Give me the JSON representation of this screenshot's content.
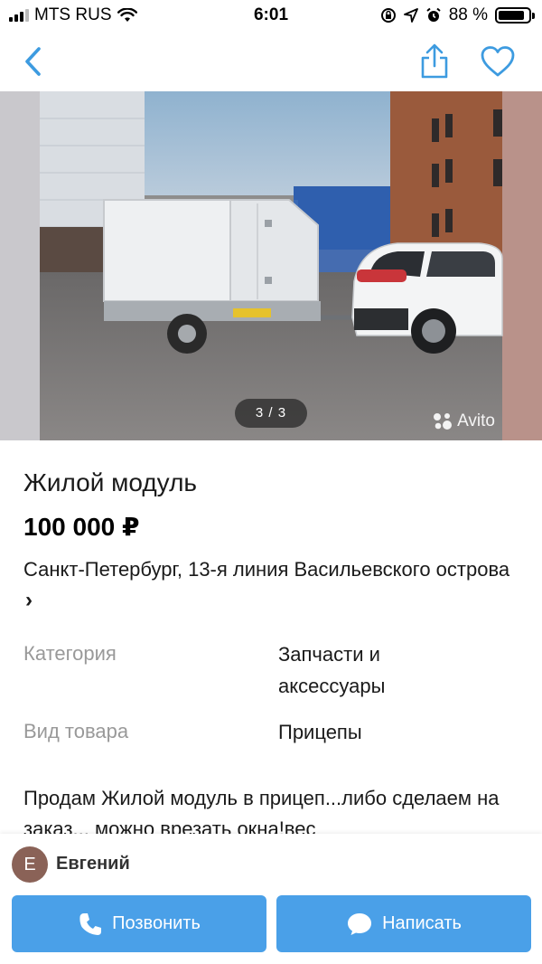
{
  "status_bar": {
    "carrier": "MTS RUS",
    "time": "6:01",
    "battery": "88 %",
    "battery_level": 0.88
  },
  "photo": {
    "counter": "3 / 3",
    "watermark": "Avito"
  },
  "listing": {
    "title": "Жилой модуль",
    "price": "100 000 ₽",
    "address": "Санкт-Петербург, 13-я линия Васильевского острова",
    "address_chevron": "›"
  },
  "params": [
    {
      "label": "Категория",
      "value": "Запчасти и аксессуары"
    },
    {
      "label": "Вид товара",
      "value": "Прицепы"
    }
  ],
  "description": "Продам Жилой модуль в прицеп...либо сделаем на заказ... можно врезать окна!вес",
  "seller": {
    "initial": "E",
    "name": "Евгений"
  },
  "actions": {
    "call_label": "Позвонить",
    "message_label": "Написать"
  },
  "colors": {
    "accent": "#4aa0e8",
    "nav_icon": "#3d9be0",
    "label_gray": "#999999",
    "avatar": "#8a6257"
  },
  "icons": {
    "back": "back-chevron-icon",
    "share": "share-icon",
    "favorite": "heart-icon",
    "call": "phone-icon",
    "message": "chat-bubble-icon"
  }
}
